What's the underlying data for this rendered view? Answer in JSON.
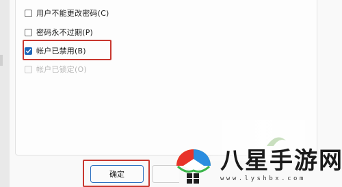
{
  "options": [
    {
      "label": "用户不能更改密码(C)",
      "checked": false,
      "disabled": false
    },
    {
      "label": "密码永不过期(P)",
      "checked": false,
      "disabled": false
    },
    {
      "label": "帐户已禁用(B)",
      "checked": true,
      "disabled": false
    },
    {
      "label": "帐户已锁定(O)",
      "checked": false,
      "disabled": true
    }
  ],
  "buttons": {
    "ok_label": "确定"
  },
  "watermark": {
    "brand_text": "八星手游网",
    "url_text": "www.lyshbx.com"
  },
  "colors": {
    "accent": "#1f66b8",
    "highlight": "#c8372f"
  }
}
